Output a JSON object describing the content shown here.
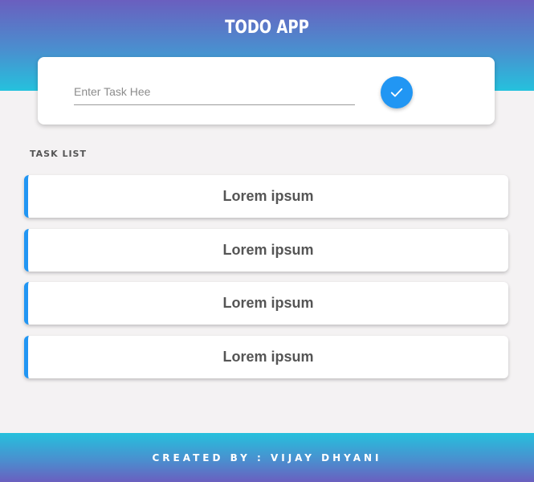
{
  "header": {
    "title": "TODO APP"
  },
  "input_card": {
    "placeholder": "Enter Task Hee",
    "value": "",
    "submit_icon": "check-icon"
  },
  "task_list": {
    "label": "TASK LIST",
    "items": [
      {
        "text": "Lorem ipsum"
      },
      {
        "text": "Lorem ipsum"
      },
      {
        "text": "Lorem ipsum"
      },
      {
        "text": "Lorem ipsum"
      }
    ]
  },
  "footer": {
    "text": "CREATED BY : VIJAY DHYANI"
  },
  "colors": {
    "accent": "#2196f3",
    "gradient_top": "#6a5fbf",
    "gradient_bottom": "#25c1dd",
    "background": "#f4f2f3"
  }
}
